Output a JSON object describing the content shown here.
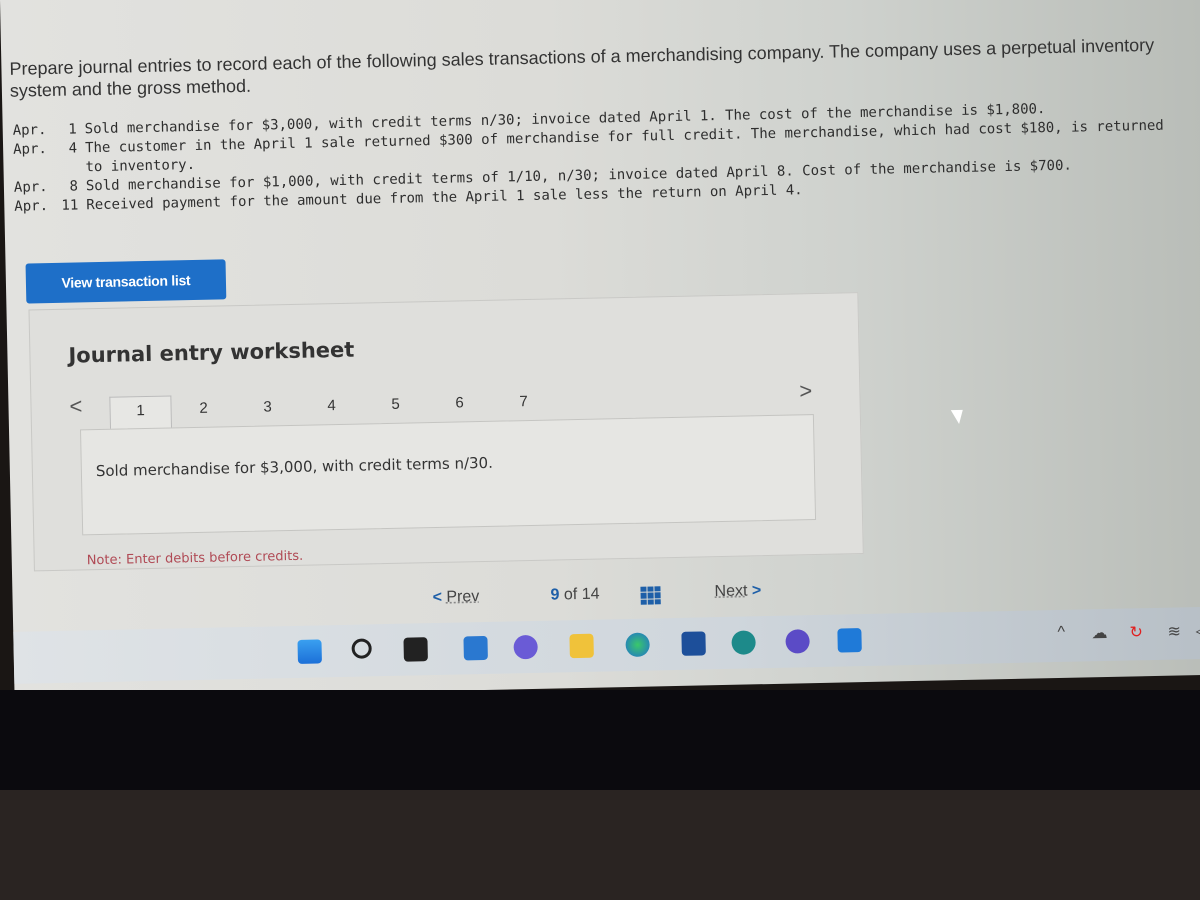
{
  "prompt": "Prepare journal entries to record each of the following sales transactions of a merchandising company. The company uses a perpetual inventory system and the gross method.",
  "transactions": [
    {
      "month": "Apr.",
      "day": "1",
      "text": "Sold merchandise for $3,000, with credit terms n/30; invoice dated April 1. The cost of the merchandise is $1,800."
    },
    {
      "month": "Apr.",
      "day": "4",
      "text": "The customer in the April 1 sale returned $300 of merchandise for full credit. The merchandise, which had cost $180, is returned to inventory."
    },
    {
      "month": "Apr.",
      "day": "8",
      "text": "Sold merchandise for $1,000, with credit terms of 1/10, n/30; invoice dated April 8. Cost of the merchandise is $700."
    },
    {
      "month": "Apr.",
      "day": "11",
      "text": "Received payment for the amount due from the April 1 sale less the return on April 4."
    }
  ],
  "view_transaction_list_label": "View transaction list",
  "worksheet": {
    "title": "Journal entry worksheet",
    "prev_tab": "<",
    "next_tab": ">",
    "tabs": [
      "1",
      "2",
      "3",
      "4",
      "5",
      "6",
      "7"
    ],
    "active_tab": "1",
    "entry_description": "Sold merchandise for $3,000, with credit terms n/30.",
    "note": "Note: Enter debits before credits."
  },
  "navigation": {
    "prev_chevron": "<",
    "prev_label": "Prev",
    "current_page": "9",
    "of_label": "of",
    "total_pages": "14",
    "next_label": "Next",
    "next_chevron": ">"
  },
  "colors": {
    "primary_button": "#1e6fc8",
    "nav_accent": "#1e5fa8",
    "note_text": "#b04a55"
  },
  "taskbar": {
    "icons": [
      "windows-start-icon",
      "search-icon",
      "task-view-icon",
      "widgets-icon",
      "teams-chat-icon",
      "file-explorer-icon",
      "edge-browser-icon",
      "microsoft-store-icon",
      "app-search-icon",
      "app-circle-icon",
      "app-square-icon"
    ],
    "tray": [
      "chevron-up-icon",
      "onedrive-cloud-icon",
      "sync-alert-icon",
      "wifi-icon",
      "volume-icon"
    ]
  }
}
